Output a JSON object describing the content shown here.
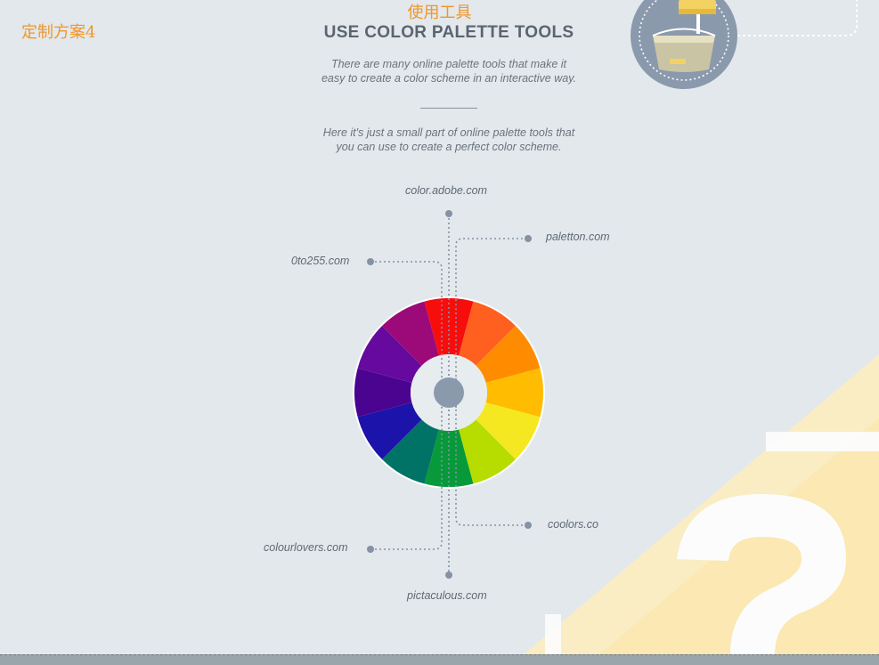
{
  "corner_label": "定制方案4",
  "subtitle_cn": "使用工具",
  "title": "USE COLOR PALETTE TOOLS",
  "intro_line1": "There are many online palette tools that make it",
  "intro_line2": "easy to create a color scheme in an interactive way.",
  "intro2_line1": "Here it's just a small part of online palette tools that",
  "intro2_line2": "you can use to create a perfect color scheme.",
  "links": {
    "adobe": "color.adobe.com",
    "paletton": "paletton.com",
    "zero_to_255": "0to255.com",
    "coolors": "coolors.co",
    "colourlovers": "colourlovers.com",
    "pictaculous": "pictaculous.com"
  },
  "colors": {
    "wheel": [
      "#f80d0d",
      "#ff5f1f",
      "#ff8c00",
      "#ffbc00",
      "#f6e820",
      "#b7dc00",
      "#089a3a",
      "#007366",
      "#1b13aa",
      "#4a048f",
      "#66099f",
      "#9b0a78"
    ],
    "accent_orange": "#f0962a",
    "hub": "#8b99ad",
    "background": "#e2e8ec"
  },
  "icons": [
    "paint-bucket-icon",
    "question-mark-icon"
  ]
}
